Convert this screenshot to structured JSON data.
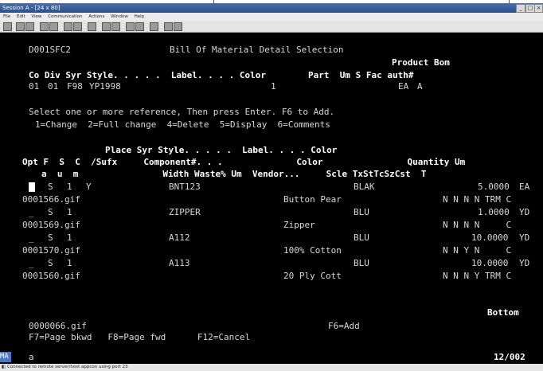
{
  "window": {
    "title": "Session A - [24 x 80]",
    "controls": [
      "_",
      "□",
      "×"
    ]
  },
  "menu": [
    "File",
    "Edit",
    "View",
    "Communication",
    "Actions",
    "Window",
    "Help"
  ],
  "screen": {
    "program": "D001SFC2",
    "title": "Bill Of Material Detail Selection",
    "hdr_product_bom": "Product Bom",
    "hdr_row1": "Co Div Syr Style. . . . .  Label. . . . Color        Part  Um S Fac auth#",
    "key_co": "01",
    "key_div": "01",
    "key_syr": "F98",
    "key_style": "YP1998",
    "key_label": "1",
    "key_um": "EA",
    "key_s": "A",
    "instruction": "Select one or more reference, Then press Enter. F6 to Add.",
    "options": "1=Change  2=Full change  4=Delete  5=Display  6=Comments",
    "col_hdr1": "Place Syr Style. . . . .  Label. . . . Color",
    "col_hdr2": "Opt F  S  C  /Sufx     Component#. . .              Color                Quantity Um",
    "col_hdr3": "a  u  m                Width Waste% Um  Vendor...     Scle TxStTcSzCst  T",
    "rows": [
      {
        "opt": "",
        "f": "S",
        "s": "1",
        "c": "Y",
        "component": "BNT123",
        "color": "BLAK",
        "qty": "5.0000",
        "um": "EA",
        "ref": "0001566.gif",
        "vendor": "Button Pear",
        "flags": "N N N N TRM C"
      },
      {
        "opt": "_",
        "f": "S",
        "s": "1",
        "c": "",
        "component": "ZIPPER",
        "color": "BLU",
        "qty": "1.0000",
        "um": "YD",
        "ref": "0001569.gif",
        "vendor": "Zipper",
        "flags": "N N N N     C"
      },
      {
        "opt": "_",
        "f": "S",
        "s": "1",
        "c": "",
        "component": "A112",
        "color": "BLU",
        "qty": "10.0000",
        "um": "YD",
        "ref": "0001570.gif",
        "vendor": "100% Cotton",
        "flags": "N N Y N     C"
      },
      {
        "opt": "_",
        "f": "S",
        "s": "1",
        "c": "",
        "component": "A113",
        "color": "BLU",
        "qty": "10.0000",
        "um": "YD",
        "ref": "0001560.gif",
        "vendor": "20 Ply Cott",
        "flags": "N N N Y TRM C"
      }
    ],
    "bottom": "Bottom",
    "footer_file": "0000066.gif",
    "f6": "F6=Add",
    "fkeys": "F7=Page bkwd   F8=Page fwd      F12=Cancel"
  },
  "status": {
    "indicator": "MA",
    "field": "a",
    "position": "12/002",
    "connection": "Connected to remote server/host appcon using port 23"
  }
}
